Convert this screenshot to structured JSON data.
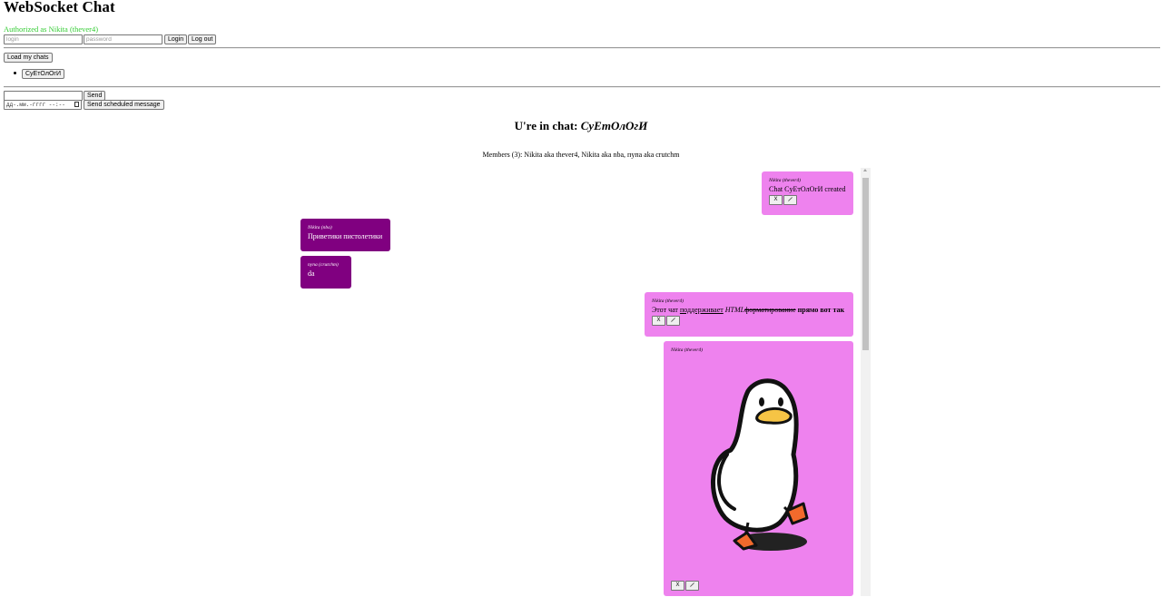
{
  "app": {
    "title": "WebSocket Chat",
    "auth_status": "Authorized as Nikita (thever4)"
  },
  "login_form": {
    "login_placeholder": "login",
    "password_placeholder": "password",
    "login_button": "Login",
    "logout_button": "Log out"
  },
  "chats": {
    "load_button": "Load my chats",
    "items": [
      {
        "label": "CуEтOлOгИ"
      }
    ]
  },
  "composer": {
    "message_value": "",
    "send_button": "Send",
    "datetime_placeholder": "дд-.мм.-гггг --:--",
    "scheduled_button": "Send scheduled message"
  },
  "chat": {
    "heading_prefix": "U're in chat: ",
    "heading_name": "CуEтOлOгИ",
    "members_text": "Members (3): Nikita aka thever4, Nikita aka nba, пупа aka crutchm"
  },
  "messages": [
    {
      "author": "Nikita (thever4)",
      "text": "Chat CуEтOлOгИ created",
      "own": true
    },
    {
      "author": "Nikita (nba)",
      "text": "Приветики пистолетики",
      "own": false
    },
    {
      "author": "пупа (crutchm)",
      "text": "da",
      "own": false
    },
    {
      "author": "Nikita (thever4)",
      "own": true,
      "text_parts": {
        "plain": "Этот чат ",
        "underlined": "поддерживает",
        "italic": " HTML",
        "struck": "форматирование",
        "bold": " прямо вот так"
      }
    },
    {
      "author": "Nikita (thever4)",
      "own": true,
      "image": "duck-sticker"
    }
  ],
  "message_tools": {
    "delete": "X",
    "edit_icon": "pencil-icon"
  },
  "colors": {
    "own_bubble": "#ee82ee",
    "other_bubble": "#800080",
    "auth_status": "#33cc33"
  }
}
